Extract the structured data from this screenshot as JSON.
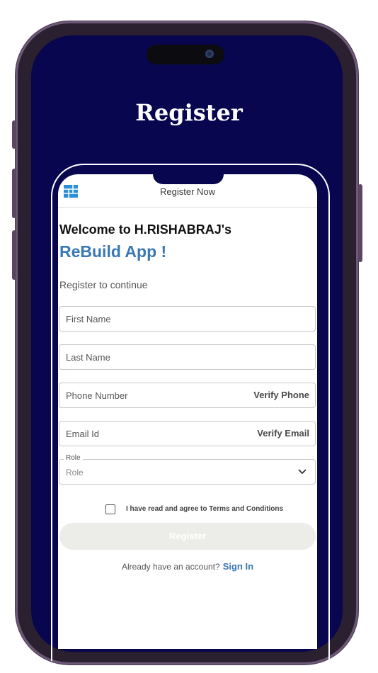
{
  "screen": {
    "title": "Register"
  },
  "appbar": {
    "title": "Register Now",
    "logo_icon": "grid-logo-icon"
  },
  "welcome": {
    "line1": "Welcome to H.RISHABRAJ's",
    "app_name": "ReBuild App !",
    "subtitle": "Register to continue"
  },
  "form": {
    "first_name_placeholder": "First Name",
    "last_name_placeholder": "Last Name",
    "phone_placeholder": "Phone Number",
    "verify_phone_label": "Verify Phone",
    "email_placeholder": "Email Id",
    "verify_email_label": "Verify Email",
    "role_label": "Role",
    "role_value": "Role"
  },
  "terms": {
    "text": "I have read and agree to Terms and Conditions",
    "checked": false
  },
  "register_button": {
    "label": "Register"
  },
  "signin": {
    "prompt": "Already have an account?",
    "link": "Sign In"
  },
  "colors": {
    "screen_bg": "#07064f",
    "accent": "#3a78b5",
    "button_disabled": "#ecece8"
  }
}
